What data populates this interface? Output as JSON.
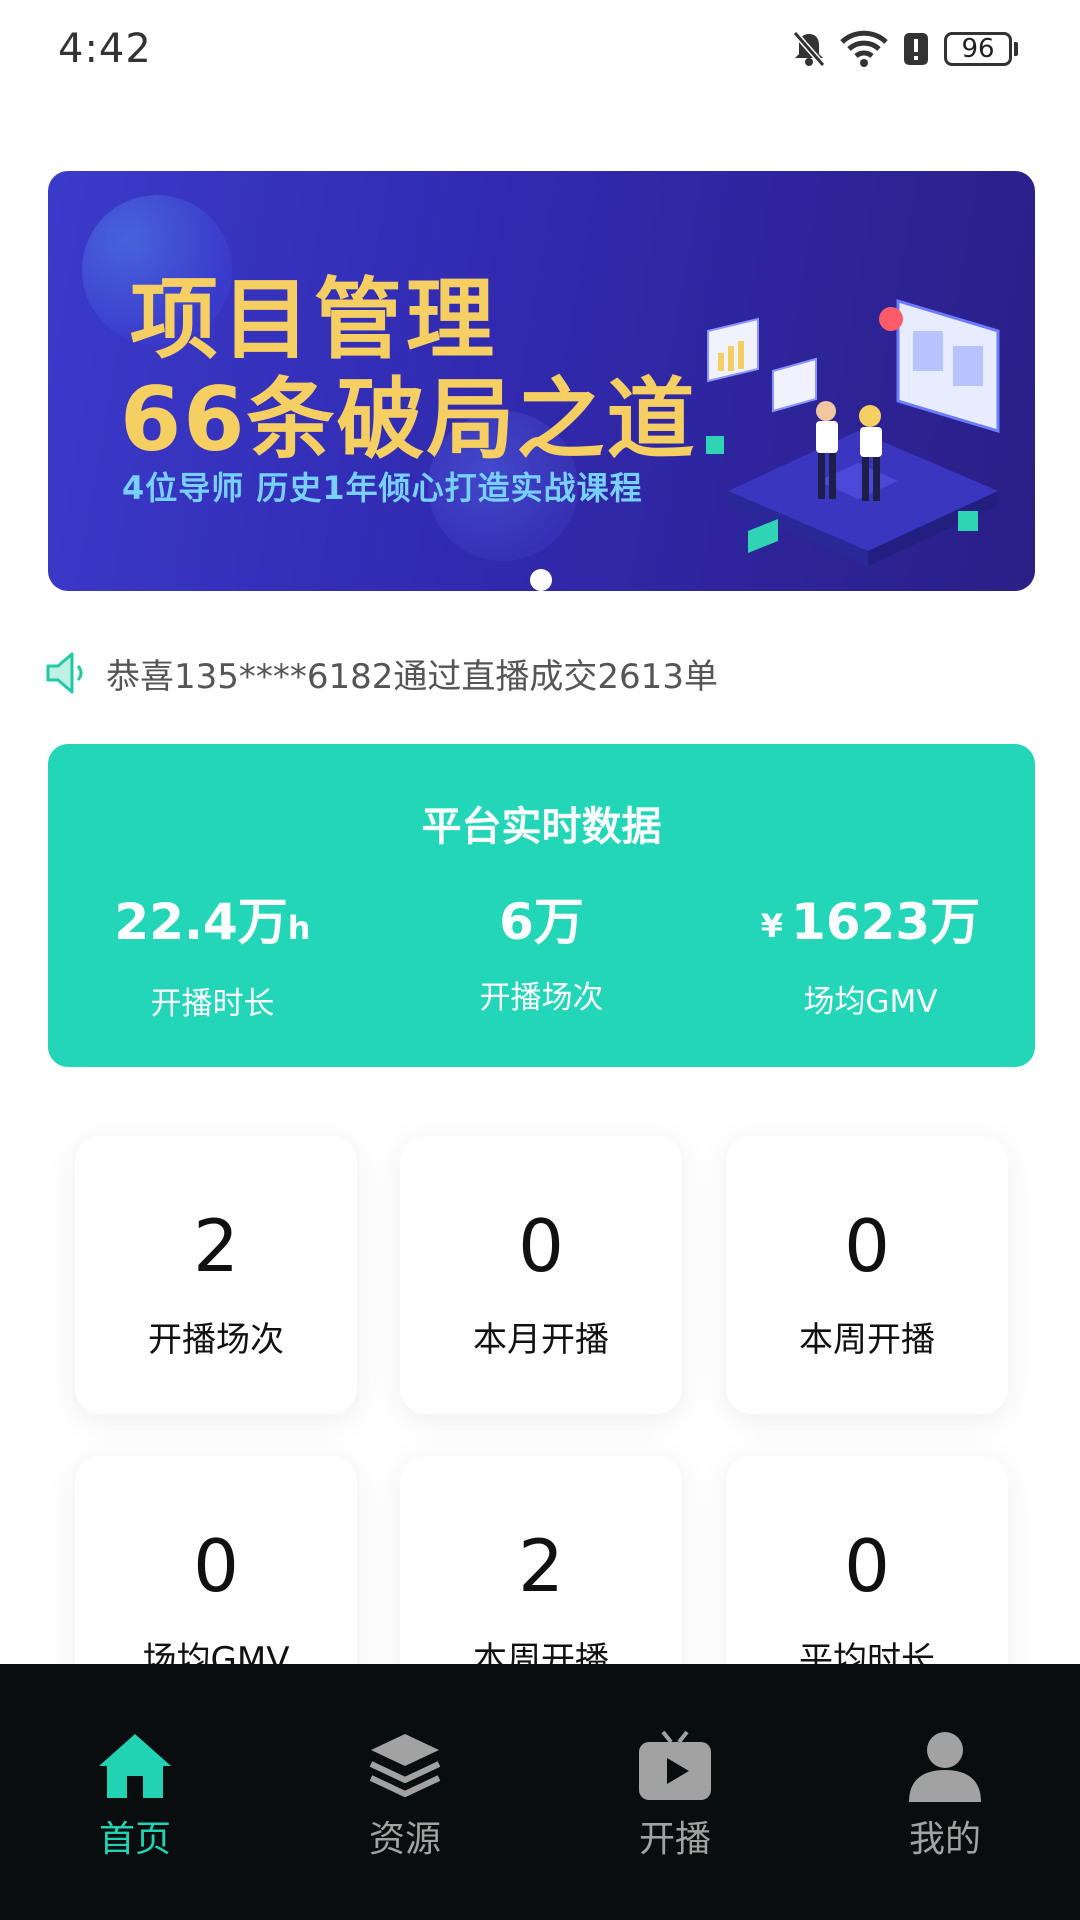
{
  "status_bar": {
    "time": "4:42",
    "battery": "96",
    "icons": [
      "mute-icon",
      "wifi-icon",
      "alert-icon",
      "battery-icon"
    ]
  },
  "banner": {
    "title_line1": "项目管理",
    "title_line2": "66条破局之道",
    "subtitle": "4位导师  历史1年倾心打造实战课程",
    "active_slide": 1,
    "slide_count": 1,
    "colors": {
      "title": "#f6cf62",
      "subtitle": "#78d0ff",
      "background": "#3532be"
    }
  },
  "notice": {
    "icon": "speaker-icon",
    "text": "恭喜135****6182通过直播成交2613单"
  },
  "platform_data": {
    "title": "平台实时数据",
    "stats": [
      {
        "value": "22.4万",
        "unit": "h",
        "label": "开播时长"
      },
      {
        "value": "6万",
        "label": "开播场次"
      },
      {
        "prefix": "¥",
        "value": "1623万",
        "label": "场均GMV"
      }
    ],
    "color": "#24d6b8"
  },
  "my_stats": [
    {
      "value": "2",
      "label": "开播场次"
    },
    {
      "value": "0",
      "label": "本月开播"
    },
    {
      "value": "0",
      "label": "本周开播"
    },
    {
      "value": "0",
      "label": "场均GMV"
    },
    {
      "value": "2",
      "label": "本周开播"
    },
    {
      "value": "0",
      "label": "平均时长"
    }
  ],
  "bottom_nav": {
    "items": [
      {
        "label": "首页",
        "icon": "home-icon",
        "active": true
      },
      {
        "label": "资源",
        "icon": "layers-icon",
        "active": false
      },
      {
        "label": "开播",
        "icon": "tv-play-icon",
        "active": false
      },
      {
        "label": "我的",
        "icon": "user-icon",
        "active": false
      }
    ],
    "active_color": "#22d3b3",
    "inactive_color": "#a2a2a2"
  }
}
